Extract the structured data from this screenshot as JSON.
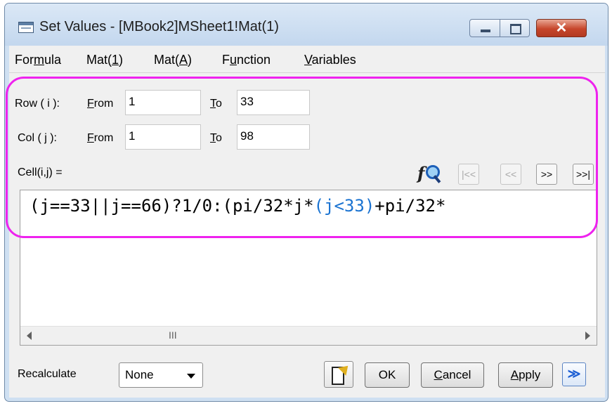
{
  "window": {
    "title": "Set Values - [MBook2]MSheet1!Mat(1)",
    "icons": {
      "app": "app-icon",
      "minimize": "minimize-icon",
      "maximize": "maximize-icon",
      "close": "close-icon"
    },
    "close_glyph": "✕"
  },
  "menu": [
    {
      "pre": "For",
      "key": "m",
      "post": "ula"
    },
    {
      "pre": "Mat(",
      "key": "1",
      "post": ")"
    },
    {
      "pre": "Mat(",
      "key": "A",
      "post": ")"
    },
    {
      "pre": "F",
      "key": "u",
      "post": "nction"
    },
    {
      "pre": "",
      "key": "V",
      "post": "ariables"
    }
  ],
  "row": {
    "label": "Row ( i ):",
    "from_label_key": "F",
    "from_label_rest": "rom",
    "from_value": "1",
    "to_label_key": "T",
    "to_label_rest": "o",
    "to_value": "33"
  },
  "col": {
    "label": "Col ( j ):",
    "from_label_key": "F",
    "from_label_rest": "rom",
    "from_value": "1",
    "to_label_key": "T",
    "to_label_rest": "o",
    "to_value": "98"
  },
  "cell_label": "Cell(i,j) =",
  "nav_buttons": {
    "first": "|<<",
    "prev": "<<",
    "next": ">>",
    "last": ">>|"
  },
  "formula": {
    "part1": "(j==33||j==66)?1/0:(pi/32*j*",
    "part2": "(j<33)",
    "part3": "+pi/32*"
  },
  "scroll_grip": "III",
  "recalculate": {
    "label": "Recalculate",
    "value": "None"
  },
  "buttons": {
    "ok": "OK",
    "cancel_key": "C",
    "cancel_rest": "ancel",
    "apply_key": "A",
    "apply_rest": "pply",
    "expand": "≫"
  },
  "colors": {
    "highlight": "#ee22ee",
    "formula_accent": "#1a73d1",
    "close_button": "#c6462b"
  }
}
